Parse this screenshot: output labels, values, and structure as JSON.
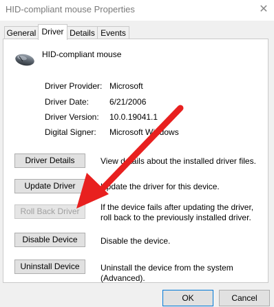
{
  "window": {
    "title": "HID-compliant mouse Properties",
    "close_glyph": "✕"
  },
  "tabs": [
    {
      "label": "General"
    },
    {
      "label": "Driver"
    },
    {
      "label": "Details"
    },
    {
      "label": "Events"
    }
  ],
  "device": {
    "name": "HID-compliant mouse",
    "icon": "mouse-icon"
  },
  "properties": [
    {
      "label": "Driver Provider:",
      "value": "Microsoft"
    },
    {
      "label": "Driver Date:",
      "value": "6/21/2006"
    },
    {
      "label": "Driver Version:",
      "value": "10.0.19041.1"
    },
    {
      "label": "Digital Signer:",
      "value": "Microsoft Windows"
    }
  ],
  "actions": [
    {
      "label": "Driver Details",
      "description": "View details about the installed driver files.",
      "enabled": true
    },
    {
      "label": "Update Driver",
      "description": "Update the driver for this device.",
      "enabled": true
    },
    {
      "label": "Roll Back Driver",
      "description": "If the device fails after updating the driver, roll back to the previously installed driver.",
      "enabled": false
    },
    {
      "label": "Disable Device",
      "description": "Disable the device.",
      "enabled": true
    },
    {
      "label": "Uninstall Device",
      "description": "Uninstall the device from the system (Advanced).",
      "enabled": true
    }
  ],
  "footer": {
    "ok_label": "OK",
    "cancel_label": "Cancel"
  },
  "annotation": {
    "color": "#e8201f"
  }
}
